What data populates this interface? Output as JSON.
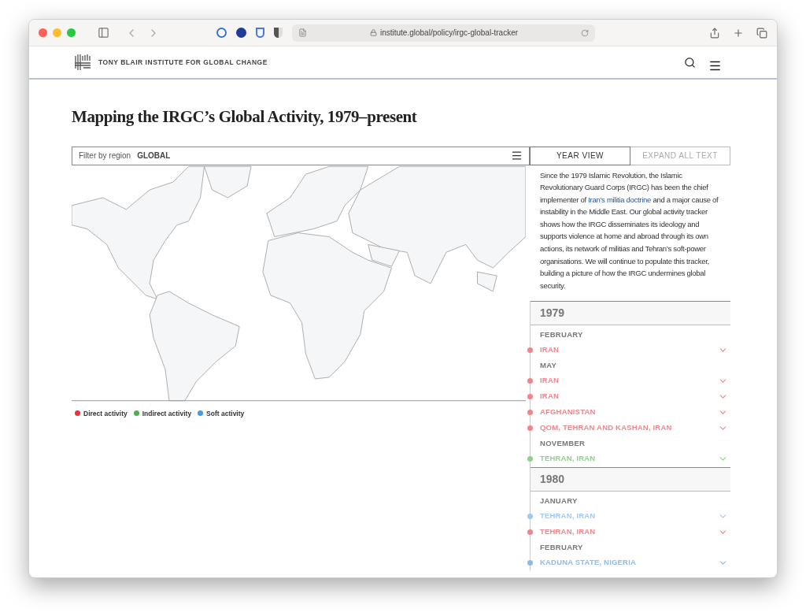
{
  "browser": {
    "url": "institute.global/policy/irgc-global-tracker"
  },
  "site": {
    "logo_text": "TONY BLAIR INSTITUTE FOR GLOBAL CHANGE"
  },
  "page_title": "Mapping the IRGC’s Global Activity, 1979–present",
  "filter": {
    "label": "Filter by region",
    "value": "GLOBAL"
  },
  "legend": [
    {
      "label": "Direct activity",
      "color": "#e8333d"
    },
    {
      "label": "Indirect activity",
      "color": "#4caf50"
    },
    {
      "label": "Soft activity",
      "color": "#3d9cf0"
    }
  ],
  "tabs": [
    {
      "label": "YEAR VIEW",
      "selected": true
    },
    {
      "label": "EXPAND ALL TEXT",
      "selected": false
    }
  ],
  "intro": {
    "before": "Since the 1979 Islamic Revolution, the Islamic Revolutionary Guard Corps (IRGC) has been the chief implementer of",
    "link": "Iran’s militia doctrine",
    "after": "and a major cause of instability in the Middle East. Our global activity tracker shows how the IRGC disseminates its ideology and supports violence at home and abroad through its own actions, its network of militias and Tehran’s soft-power organisations. We will continue to populate this tracker, building a picture of how the IRGC undermines global security."
  },
  "timeline": [
    {
      "year": "1979",
      "months": [
        {
          "name": "FEBRUARY",
          "events": [
            {
              "place": "IRAN",
              "color": "#f0868d"
            }
          ]
        },
        {
          "name": "MAY",
          "events": [
            {
              "place": "IRAN",
              "color": "#f0868d"
            },
            {
              "place": "IRAN",
              "color": "#f0868d"
            },
            {
              "place": "AFGHANISTAN",
              "color": "#f0868d"
            },
            {
              "place": "QOM, TEHRAN AND KASHAN, IRAN",
              "color": "#f0868d"
            }
          ]
        },
        {
          "name": "NOVEMBER",
          "events": [
            {
              "place": "TEHRAN, IRAN",
              "color": "#93cf8e"
            }
          ]
        }
      ]
    },
    {
      "year": "1980",
      "months": [
        {
          "name": "JANUARY",
          "events": [
            {
              "place": "TEHRAN, IRAN",
              "color": "#9fcaf4"
            },
            {
              "place": "TEHRAN, IRAN",
              "color": "#f0868d"
            }
          ]
        },
        {
          "name": "FEBRUARY",
          "events": [
            {
              "place": "KADUNA STATE, NIGERIA",
              "color": "#8dbcec"
            }
          ]
        }
      ]
    }
  ]
}
